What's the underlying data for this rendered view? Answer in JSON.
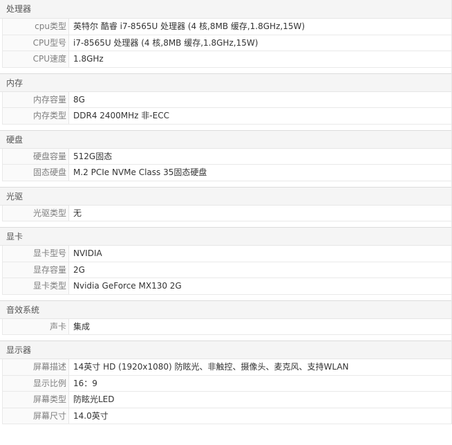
{
  "sections": [
    {
      "title": "处理器",
      "rows": [
        {
          "label": "cpu类型",
          "value": "英特尔 酷睿 i7-8565U 处理器 (4 核,8MB 缓存,1.8GHz,15W)"
        },
        {
          "label": "CPU型号",
          "value": "i7-8565U 处理器 (4 核,8MB 缓存,1.8GHz,15W)"
        },
        {
          "label": "CPU速度",
          "value": "1.8GHz"
        }
      ]
    },
    {
      "title": "内存",
      "rows": [
        {
          "label": "内存容量",
          "value": "8G"
        },
        {
          "label": "内存类型",
          "value": "DDR4 2400MHz 非-ECC"
        }
      ]
    },
    {
      "title": "硬盘",
      "rows": [
        {
          "label": "硬盘容量",
          "value": "512G固态"
        },
        {
          "label": "固态硬盘",
          "value": "M.2 PCIe NVMe Class 35固态硬盘"
        }
      ]
    },
    {
      "title": "光驱",
      "rows": [
        {
          "label": "光驱类型",
          "value": "无"
        }
      ]
    },
    {
      "title": "显卡",
      "rows": [
        {
          "label": "显卡型号",
          "value": "NVIDIA"
        },
        {
          "label": "显存容量",
          "value": "2G"
        },
        {
          "label": "显卡类型",
          "value": "Nvidia GeForce MX130 2G"
        }
      ]
    },
    {
      "title": "音效系统",
      "rows": [
        {
          "label": "声卡",
          "value": "集成"
        }
      ]
    },
    {
      "title": "显示器",
      "rows": [
        {
          "label": "屏幕描述",
          "value": "14英寸 HD (1920x1080) 防眩光、非触控、摄像头、麦克风、支持WLAN"
        },
        {
          "label": "显示比例",
          "value": "16：9"
        },
        {
          "label": "屏幕类型",
          "value": "防眩光LED"
        },
        {
          "label": "屏幕尺寸",
          "value": "14.0英寸"
        }
      ]
    }
  ]
}
